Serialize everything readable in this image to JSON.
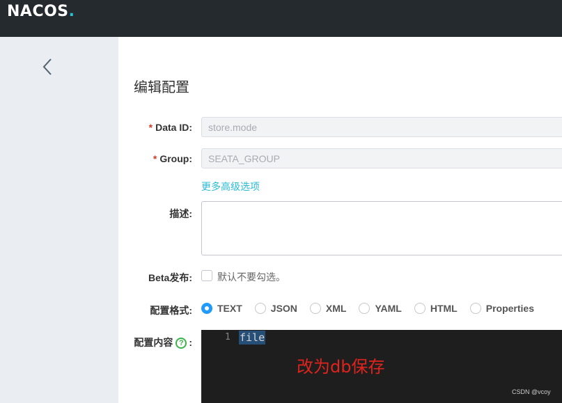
{
  "brand": {
    "logo_text": "NACOS",
    "logo_dot": "."
  },
  "colors": {
    "header_bg": "#252a2f",
    "accent": "#2bbcd6",
    "radio_selected": "#209bfa",
    "required": "#d23c26",
    "annotation": "#e0231c"
  },
  "page": {
    "title": "编辑配置"
  },
  "form": {
    "data_id": {
      "label": "Data ID:",
      "value": "store.mode"
    },
    "group": {
      "label": "Group:",
      "value": "SEATA_GROUP"
    },
    "required_mark": "*",
    "advanced_link": "更多高级选项",
    "description": {
      "label": "描述:"
    },
    "beta": {
      "label": "Beta发布:",
      "option_text": "默认不要勾选。"
    },
    "format": {
      "label": "配置格式:",
      "options": [
        "TEXT",
        "JSON",
        "XML",
        "YAML",
        "HTML",
        "Properties"
      ],
      "selected": "TEXT"
    },
    "content": {
      "label": "配置内容",
      "help_icon": "?",
      "colon": ":"
    }
  },
  "editor": {
    "line_number": "1",
    "code": "file"
  },
  "annotation": "改为db保存",
  "watermark": "CSDN @vcoy"
}
